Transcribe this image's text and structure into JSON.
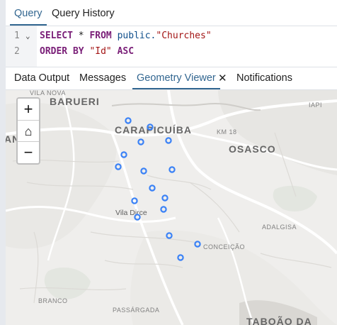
{
  "query_tabs": [
    "Query",
    "Query History"
  ],
  "editor": {
    "lines": [
      {
        "num": "1",
        "fold": true,
        "tokens": [
          {
            "t": "SELECT",
            "c": "kw"
          },
          {
            "t": " * ",
            "c": ""
          },
          {
            "t": "FROM",
            "c": "kw"
          },
          {
            "t": " public.",
            "c": "id"
          },
          {
            "t": "\"Churches\"",
            "c": "str"
          }
        ]
      },
      {
        "num": "2",
        "fold": false,
        "tokens": [
          {
            "t": "ORDER BY",
            "c": "kw"
          },
          {
            "t": " ",
            "c": ""
          },
          {
            "t": "\"Id\"",
            "c": "str"
          },
          {
            "t": " ",
            "c": ""
          },
          {
            "t": "ASC",
            "c": "kw"
          }
        ]
      }
    ]
  },
  "output_tabs": {
    "data_output": "Data Output",
    "messages": "Messages",
    "geometry_viewer": "Geometry Viewer",
    "close": "✕",
    "notifications": "Notifications"
  },
  "zoom": {
    "in": "+",
    "home": "⌂",
    "out": "−"
  },
  "map_labels": {
    "vila_nova": "VILA NOVA",
    "barueri": "BARUERI",
    "carapicuiba": "CARAPICUÍBA",
    "osasco": "OSASCO",
    "vila_dirce": "Vila Dirce",
    "adalgisa": "ADALGISA",
    "conceicao": "CONCEIÇÃO",
    "km18": "KM 18",
    "iapi": "IAPI",
    "ana": "ANA",
    "branco": "BRANCO",
    "passargada": "PASSÁRGADA",
    "taboao": "TABOÃO DA"
  },
  "colors": {
    "accent": "#326690",
    "marker": "#3b82f6"
  }
}
